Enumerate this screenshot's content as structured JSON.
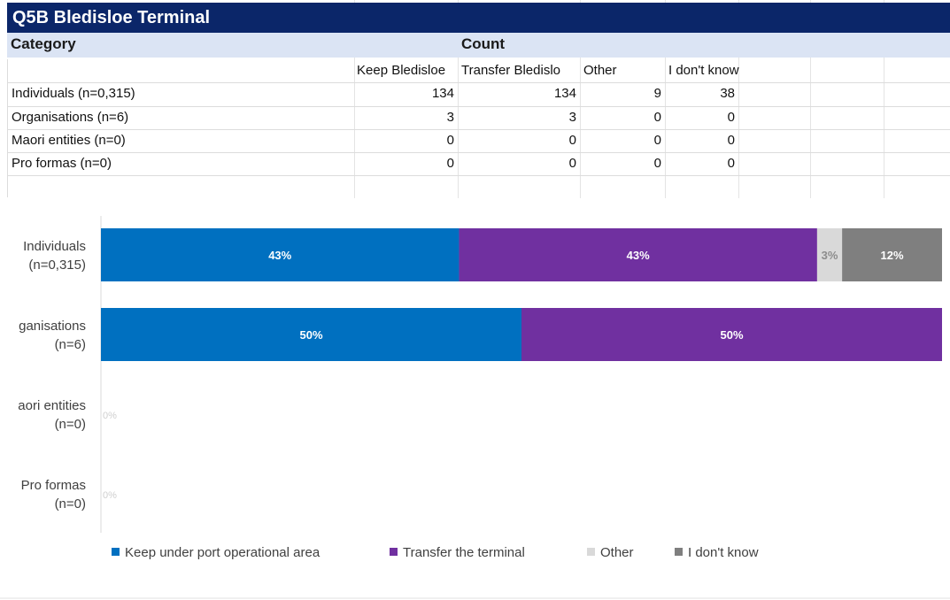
{
  "sheet": {
    "title": "Q5B Bledisloe Terminal",
    "header": {
      "category": "Category",
      "count": "Count"
    },
    "columns": [
      "Keep Bledisloe",
      "Transfer Bledislo",
      "Other",
      "I don't know"
    ],
    "rows": [
      {
        "category": "Individuals (n=0,315)",
        "keep": "134",
        "transfer": "134",
        "other": "9",
        "dont_know": "38"
      },
      {
        "category": "Organisations (n=6)",
        "keep": "3",
        "transfer": "3",
        "other": "0",
        "dont_know": "0"
      },
      {
        "category": "Maori entities (n=0)",
        "keep": "0",
        "transfer": "0",
        "other": "0",
        "dont_know": "0"
      },
      {
        "category": "Pro formas (n=0)",
        "keep": "0",
        "transfer": "0",
        "other": "0",
        "dont_know": "0"
      }
    ]
  },
  "chart_data": {
    "type": "bar",
    "orientation": "horizontal",
    "stacked": "percent",
    "categories": [
      [
        "Individuals",
        "(n=0,315)"
      ],
      [
        "ganisations",
        "(n=6)"
      ],
      [
        "aori entities",
        "(n=0)"
      ],
      [
        "Pro formas",
        "(n=0)"
      ]
    ],
    "series": [
      {
        "name": "Keep under port operational area",
        "color": "#0070c0",
        "values": [
          43,
          50,
          0,
          0
        ],
        "labels": [
          "43%",
          "50%",
          "",
          ""
        ]
      },
      {
        "name": "Transfer the terminal",
        "color": "#7030a0",
        "values": [
          43,
          50,
          0,
          0
        ],
        "labels": [
          "43%",
          "50%",
          "",
          ""
        ]
      },
      {
        "name": "Other",
        "color": "#d9d9d9",
        "values": [
          3,
          0,
          0,
          0
        ],
        "labels": [
          "3%",
          "",
          "",
          ""
        ]
      },
      {
        "name": "I don't know",
        "color": "#7f7f7f",
        "values": [
          12,
          0,
          0,
          0
        ],
        "labels": [
          "12%",
          "",
          "",
          ""
        ]
      }
    ],
    "raw_counts": [
      [
        134,
        134,
        9,
        38
      ],
      [
        3,
        3,
        0,
        0
      ],
      [
        0,
        0,
        0,
        0
      ],
      [
        0,
        0,
        0,
        0
      ]
    ],
    "zero_row_labels": [
      "0%",
      "0%"
    ],
    "legend": "bottom",
    "grid": false
  }
}
